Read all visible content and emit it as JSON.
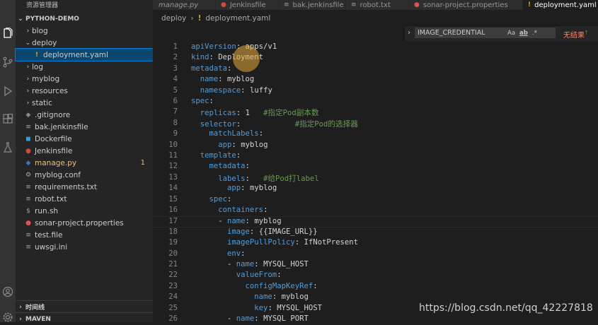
{
  "sidebar": {
    "title": "资源管理器",
    "project": "PYTHON-DEMO",
    "tree": [
      {
        "name": "blog",
        "type": "folder",
        "depth": 0,
        "open": false
      },
      {
        "name": "deploy",
        "type": "folder",
        "depth": 0,
        "open": true
      },
      {
        "name": "deployment.yaml",
        "type": "yaml",
        "depth": 1,
        "selected": true
      },
      {
        "name": "log",
        "type": "folder",
        "depth": 0,
        "open": false
      },
      {
        "name": "myblog",
        "type": "folder",
        "depth": 0,
        "open": false
      },
      {
        "name": "resources",
        "type": "folder",
        "depth": 0,
        "open": false
      },
      {
        "name": "static",
        "type": "folder",
        "depth": 0,
        "open": false
      },
      {
        "name": ".gitignore",
        "type": "git",
        "depth": 0
      },
      {
        "name": "bak.jenkinsfile",
        "type": "file",
        "depth": 0
      },
      {
        "name": "Dockerfile",
        "type": "docker",
        "depth": 0
      },
      {
        "name": "Jenkinsfile",
        "type": "jenkins",
        "depth": 0
      },
      {
        "name": "manage.py",
        "type": "python",
        "depth": 0,
        "modified": true,
        "badge": "1"
      },
      {
        "name": "myblog.conf",
        "type": "conf",
        "depth": 0
      },
      {
        "name": "requirements.txt",
        "type": "file",
        "depth": 0
      },
      {
        "name": "robot.txt",
        "type": "file",
        "depth": 0
      },
      {
        "name": "run.sh",
        "type": "shell",
        "depth": 0
      },
      {
        "name": "sonar-project.properties",
        "type": "props",
        "depth": 0
      },
      {
        "name": "test.file",
        "type": "file",
        "depth": 0
      },
      {
        "name": "uwsgi.ini",
        "type": "file",
        "depth": 0
      }
    ],
    "timeline": "时间线",
    "maven": "MAVEN"
  },
  "tabs": [
    {
      "label": "manage.py",
      "icon": "python-icon",
      "italic": true
    },
    {
      "label": "Jenkinsfile",
      "icon": "jenkins-icon"
    },
    {
      "label": "bak.jenkinsfile",
      "icon": "file-icon"
    },
    {
      "label": "robot.txt",
      "icon": "file-icon"
    },
    {
      "label": "sonar-project.properties",
      "icon": "properties-icon"
    },
    {
      "label": "deployment.yaml",
      "icon": "yaml-icon",
      "active": true
    }
  ],
  "breadcrumb": {
    "folder": "deploy",
    "file": "deployment.yaml",
    "file_icon": "!"
  },
  "find": {
    "value": "IMAGE_CREDENTIAL",
    "result": "无结果"
  },
  "code_lines": [
    [
      [
        "k",
        "apiVersion"
      ],
      [
        "p",
        ": "
      ],
      [
        "v",
        "apps/v1"
      ]
    ],
    [
      [
        "k",
        "kind"
      ],
      [
        "p",
        ": "
      ],
      [
        "v",
        "Deployment"
      ]
    ],
    [
      [
        "k",
        "metadata"
      ],
      [
        "p",
        ":"
      ]
    ],
    [
      [
        "p",
        "  "
      ],
      [
        "k",
        "name"
      ],
      [
        "p",
        ": "
      ],
      [
        "v",
        "myblog"
      ]
    ],
    [
      [
        "p",
        "  "
      ],
      [
        "k",
        "namespace"
      ],
      [
        "p",
        ": "
      ],
      [
        "v",
        "luffy"
      ]
    ],
    [
      [
        "k",
        "spec"
      ],
      [
        "p",
        ":"
      ]
    ],
    [
      [
        "p",
        "  "
      ],
      [
        "k",
        "replicas"
      ],
      [
        "p",
        ": "
      ],
      [
        "v",
        "1"
      ],
      [
        "p",
        "   "
      ],
      [
        "c",
        "#指定Pod副本数"
      ]
    ],
    [
      [
        "p",
        "  "
      ],
      [
        "k",
        "selector"
      ],
      [
        "p",
        ":"
      ],
      [
        "p",
        "            "
      ],
      [
        "c",
        "#指定Pod的选择器"
      ]
    ],
    [
      [
        "p",
        "    "
      ],
      [
        "k",
        "matchLabels"
      ],
      [
        "p",
        ":"
      ]
    ],
    [
      [
        "p",
        "      "
      ],
      [
        "k",
        "app"
      ],
      [
        "p",
        ": "
      ],
      [
        "v",
        "myblog"
      ]
    ],
    [
      [
        "p",
        "  "
      ],
      [
        "k",
        "template"
      ],
      [
        "p",
        ":"
      ]
    ],
    [
      [
        "p",
        "    "
      ],
      [
        "k",
        "metadata"
      ],
      [
        "p",
        ":"
      ]
    ],
    [
      [
        "p",
        "      "
      ],
      [
        "k",
        "labels"
      ],
      [
        "p",
        ":   "
      ],
      [
        "c",
        "#给Pod打label"
      ]
    ],
    [
      [
        "p",
        "        "
      ],
      [
        "k",
        "app"
      ],
      [
        "p",
        ": "
      ],
      [
        "v",
        "myblog"
      ]
    ],
    [
      [
        "p",
        "    "
      ],
      [
        "k",
        "spec"
      ],
      [
        "p",
        ":"
      ]
    ],
    [
      [
        "p",
        "      "
      ],
      [
        "k",
        "containers"
      ],
      [
        "p",
        ":"
      ]
    ],
    [
      [
        "p",
        "      - "
      ],
      [
        "k",
        "name"
      ],
      [
        "p",
        ": "
      ],
      [
        "v",
        "myblog"
      ]
    ],
    [
      [
        "p",
        "        "
      ],
      [
        "k",
        "image"
      ],
      [
        "p",
        ": "
      ],
      [
        "v",
        "{{IMAGE_URL}}"
      ]
    ],
    [
      [
        "p",
        "        "
      ],
      [
        "k",
        "imagePullPolicy"
      ],
      [
        "p",
        ": "
      ],
      [
        "v",
        "IfNotPresent"
      ]
    ],
    [
      [
        "p",
        "        "
      ],
      [
        "k",
        "env"
      ],
      [
        "p",
        ":"
      ]
    ],
    [
      [
        "p",
        "        - "
      ],
      [
        "k",
        "name"
      ],
      [
        "p",
        ": "
      ],
      [
        "v",
        "MYSQL_HOST"
      ]
    ],
    [
      [
        "p",
        "          "
      ],
      [
        "k",
        "valueFrom"
      ],
      [
        "p",
        ":"
      ]
    ],
    [
      [
        "p",
        "            "
      ],
      [
        "k",
        "configMapKeyRef"
      ],
      [
        "p",
        ":"
      ]
    ],
    [
      [
        "p",
        "              "
      ],
      [
        "k",
        "name"
      ],
      [
        "p",
        ": "
      ],
      [
        "v",
        "myblog"
      ]
    ],
    [
      [
        "p",
        "              "
      ],
      [
        "k",
        "key"
      ],
      [
        "p",
        ": "
      ],
      [
        "v",
        "MYSQL_HOST"
      ]
    ],
    [
      [
        "p",
        "        - "
      ],
      [
        "k",
        "name"
      ],
      [
        "p",
        ": "
      ],
      [
        "v",
        "MYSQL_PORT"
      ]
    ]
  ],
  "watermark": "https://blog.csdn.net/qq_42227818"
}
